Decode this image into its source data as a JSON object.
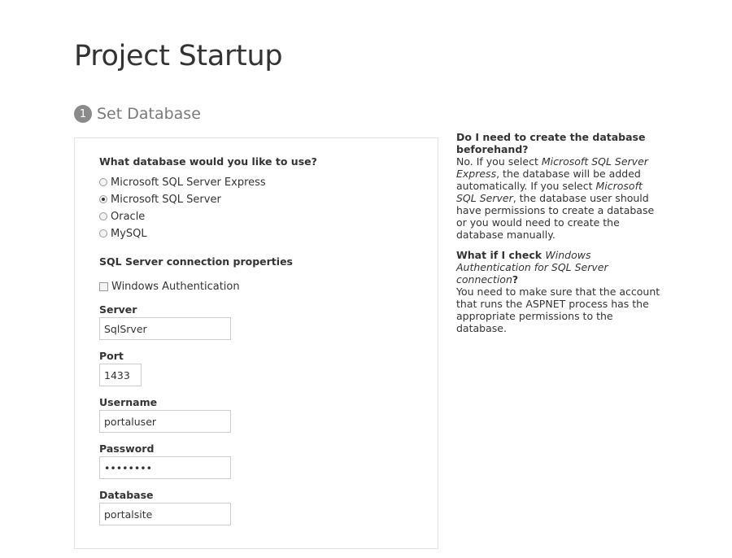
{
  "page": {
    "title": "Project Startup"
  },
  "step": {
    "number": "1",
    "label": "Set Database"
  },
  "database_choice": {
    "question": "What database would you like to use?",
    "options": [
      {
        "label": "Microsoft SQL Server Express",
        "selected": false
      },
      {
        "label": "Microsoft SQL Server",
        "selected": true
      },
      {
        "label": "Oracle",
        "selected": false
      },
      {
        "label": "MySQL",
        "selected": false
      }
    ]
  },
  "connection": {
    "heading": "SQL Server connection properties",
    "windows_auth_label": "Windows Authentication",
    "windows_auth_checked": false,
    "server": {
      "label": "Server",
      "value": "SqlSrver"
    },
    "port": {
      "label": "Port",
      "value": "1433"
    },
    "username": {
      "label": "Username",
      "value": "portaluser"
    },
    "password": {
      "label": "Password",
      "value": "password"
    },
    "database": {
      "label": "Database",
      "value": "portalsite"
    }
  },
  "help": {
    "q1_title": "Do I need to create the database beforehand?",
    "q1_a_1": "No. If you select ",
    "q1_a_em1": "Microsoft SQL Server Express",
    "q1_a_2": ", the database will be added automatically. If you select ",
    "q1_a_em2": "Microsoft SQL Server",
    "q1_a_3": ", the database user should have permissions to create a database or you would need to create the database manually.",
    "q2_title_1": "What if I check ",
    "q2_title_em": "Windows Authentication for SQL Server connection",
    "q2_title_2": "?",
    "q2_answer": "You need to make sure that the account that runs the ASPNET process has the appropriate permissions to the database."
  }
}
